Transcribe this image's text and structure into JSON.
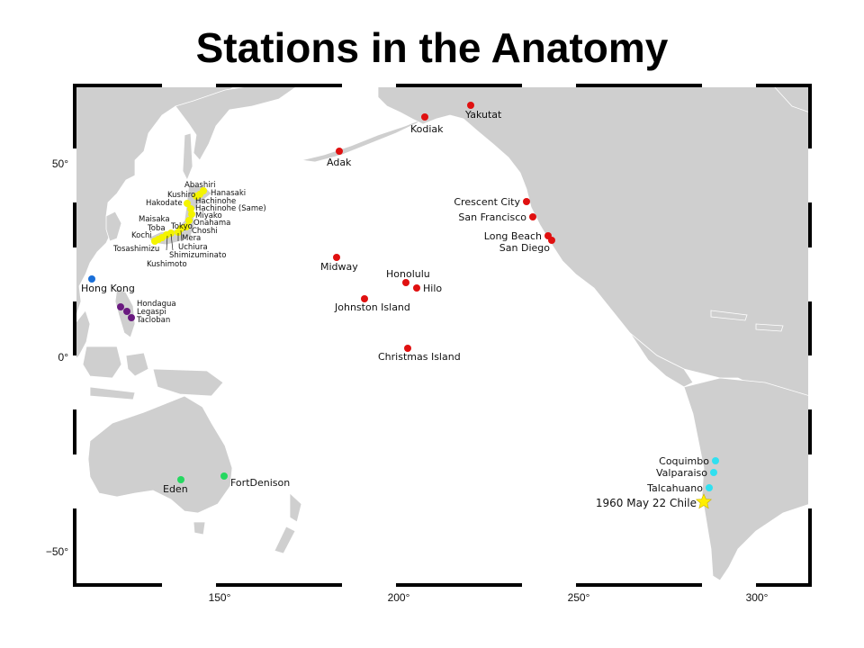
{
  "title": "Stations in the Anatomy",
  "axes": {
    "x_ticks": [
      "150°",
      "200°",
      "250°",
      "300°"
    ],
    "y_ticks": [
      "50°",
      "0°",
      "−50°"
    ]
  },
  "colors": {
    "red": "#e01010",
    "yellow": "#f4f400",
    "blue": "#1a6fd8",
    "purple": "#6a1a80",
    "green": "#25d860",
    "cyan": "#30e0f0",
    "star": "#ffee00"
  },
  "stations": {
    "yakutat": "Yakutat",
    "kodiak": "Kodiak",
    "adak": "Adak",
    "crescent_city": "Crescent City",
    "san_francisco": "San Francisco",
    "long_beach": "Long Beach",
    "san_diego": "San Diego",
    "midway": "Midway",
    "honolulu": "Honolulu",
    "hilo": "Hilo",
    "johnston_island": "Johnston Island",
    "christmas_island": "Christmas Island",
    "hong_kong": "Hong Kong",
    "hondagua": "Hondagua",
    "legaspi": "Legaspi",
    "tacloban": "Tacloban",
    "eden": "Eden",
    "fort_denison": "FortDenison",
    "coquimbo": "Coquimbo",
    "valparaiso": "Valparaiso",
    "talcahuano": "Talcahuano",
    "chile_1960": "1960 May 22 Chile",
    "abashiri": "Abashiri",
    "hanasaki": "Hanasaki",
    "kushiro": "Kushiro",
    "hachinohe": "Hachinohe",
    "hakodate": "Hakodate",
    "hachinohe_same": "Hachinohe (Same)",
    "miyako": "Miyako",
    "maisaka": "Maisaka",
    "onahama": "Onahama",
    "toba": "Toba",
    "tokyo": "Tokyo",
    "choshi": "Choshi",
    "kochi": "Kochi",
    "mera": "Mera",
    "uchiura": "Uchiura",
    "tosashimizu": "Tosashimizu",
    "shimizuminato": "Shimizuminato",
    "kushimoto": "Kushimoto"
  }
}
